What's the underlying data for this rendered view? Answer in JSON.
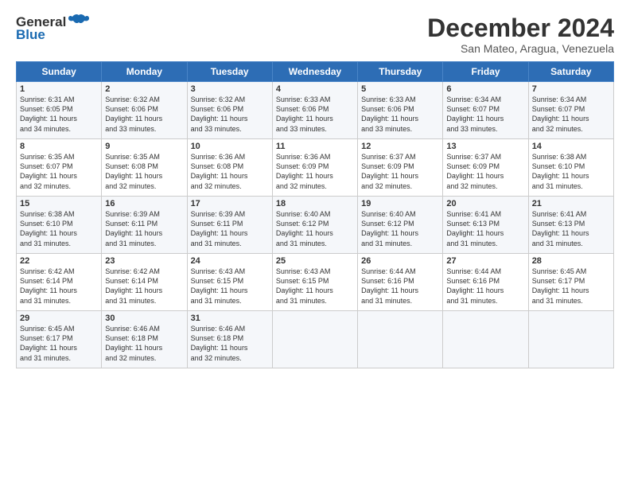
{
  "logo": {
    "line1": "General",
    "line2": "Blue"
  },
  "title": "December 2024",
  "subtitle": "San Mateo, Aragua, Venezuela",
  "days_header": [
    "Sunday",
    "Monday",
    "Tuesday",
    "Wednesday",
    "Thursday",
    "Friday",
    "Saturday"
  ],
  "weeks": [
    [
      {
        "day": "1",
        "info": "Sunrise: 6:31 AM\nSunset: 6:05 PM\nDaylight: 11 hours\nand 34 minutes."
      },
      {
        "day": "2",
        "info": "Sunrise: 6:32 AM\nSunset: 6:06 PM\nDaylight: 11 hours\nand 33 minutes."
      },
      {
        "day": "3",
        "info": "Sunrise: 6:32 AM\nSunset: 6:06 PM\nDaylight: 11 hours\nand 33 minutes."
      },
      {
        "day": "4",
        "info": "Sunrise: 6:33 AM\nSunset: 6:06 PM\nDaylight: 11 hours\nand 33 minutes."
      },
      {
        "day": "5",
        "info": "Sunrise: 6:33 AM\nSunset: 6:06 PM\nDaylight: 11 hours\nand 33 minutes."
      },
      {
        "day": "6",
        "info": "Sunrise: 6:34 AM\nSunset: 6:07 PM\nDaylight: 11 hours\nand 33 minutes."
      },
      {
        "day": "7",
        "info": "Sunrise: 6:34 AM\nSunset: 6:07 PM\nDaylight: 11 hours\nand 32 minutes."
      }
    ],
    [
      {
        "day": "8",
        "info": "Sunrise: 6:35 AM\nSunset: 6:07 PM\nDaylight: 11 hours\nand 32 minutes."
      },
      {
        "day": "9",
        "info": "Sunrise: 6:35 AM\nSunset: 6:08 PM\nDaylight: 11 hours\nand 32 minutes."
      },
      {
        "day": "10",
        "info": "Sunrise: 6:36 AM\nSunset: 6:08 PM\nDaylight: 11 hours\nand 32 minutes."
      },
      {
        "day": "11",
        "info": "Sunrise: 6:36 AM\nSunset: 6:09 PM\nDaylight: 11 hours\nand 32 minutes."
      },
      {
        "day": "12",
        "info": "Sunrise: 6:37 AM\nSunset: 6:09 PM\nDaylight: 11 hours\nand 32 minutes."
      },
      {
        "day": "13",
        "info": "Sunrise: 6:37 AM\nSunset: 6:09 PM\nDaylight: 11 hours\nand 32 minutes."
      },
      {
        "day": "14",
        "info": "Sunrise: 6:38 AM\nSunset: 6:10 PM\nDaylight: 11 hours\nand 31 minutes."
      }
    ],
    [
      {
        "day": "15",
        "info": "Sunrise: 6:38 AM\nSunset: 6:10 PM\nDaylight: 11 hours\nand 31 minutes."
      },
      {
        "day": "16",
        "info": "Sunrise: 6:39 AM\nSunset: 6:11 PM\nDaylight: 11 hours\nand 31 minutes."
      },
      {
        "day": "17",
        "info": "Sunrise: 6:39 AM\nSunset: 6:11 PM\nDaylight: 11 hours\nand 31 minutes."
      },
      {
        "day": "18",
        "info": "Sunrise: 6:40 AM\nSunset: 6:12 PM\nDaylight: 11 hours\nand 31 minutes."
      },
      {
        "day": "19",
        "info": "Sunrise: 6:40 AM\nSunset: 6:12 PM\nDaylight: 11 hours\nand 31 minutes."
      },
      {
        "day": "20",
        "info": "Sunrise: 6:41 AM\nSunset: 6:13 PM\nDaylight: 11 hours\nand 31 minutes."
      },
      {
        "day": "21",
        "info": "Sunrise: 6:41 AM\nSunset: 6:13 PM\nDaylight: 11 hours\nand 31 minutes."
      }
    ],
    [
      {
        "day": "22",
        "info": "Sunrise: 6:42 AM\nSunset: 6:14 PM\nDaylight: 11 hours\nand 31 minutes."
      },
      {
        "day": "23",
        "info": "Sunrise: 6:42 AM\nSunset: 6:14 PM\nDaylight: 11 hours\nand 31 minutes."
      },
      {
        "day": "24",
        "info": "Sunrise: 6:43 AM\nSunset: 6:15 PM\nDaylight: 11 hours\nand 31 minutes."
      },
      {
        "day": "25",
        "info": "Sunrise: 6:43 AM\nSunset: 6:15 PM\nDaylight: 11 hours\nand 31 minutes."
      },
      {
        "day": "26",
        "info": "Sunrise: 6:44 AM\nSunset: 6:16 PM\nDaylight: 11 hours\nand 31 minutes."
      },
      {
        "day": "27",
        "info": "Sunrise: 6:44 AM\nSunset: 6:16 PM\nDaylight: 11 hours\nand 31 minutes."
      },
      {
        "day": "28",
        "info": "Sunrise: 6:45 AM\nSunset: 6:17 PM\nDaylight: 11 hours\nand 31 minutes."
      }
    ],
    [
      {
        "day": "29",
        "info": "Sunrise: 6:45 AM\nSunset: 6:17 PM\nDaylight: 11 hours\nand 31 minutes."
      },
      {
        "day": "30",
        "info": "Sunrise: 6:46 AM\nSunset: 6:18 PM\nDaylight: 11 hours\nand 32 minutes."
      },
      {
        "day": "31",
        "info": "Sunrise: 6:46 AM\nSunset: 6:18 PM\nDaylight: 11 hours\nand 32 minutes."
      },
      {
        "day": "",
        "info": ""
      },
      {
        "day": "",
        "info": ""
      },
      {
        "day": "",
        "info": ""
      },
      {
        "day": "",
        "info": ""
      }
    ]
  ]
}
